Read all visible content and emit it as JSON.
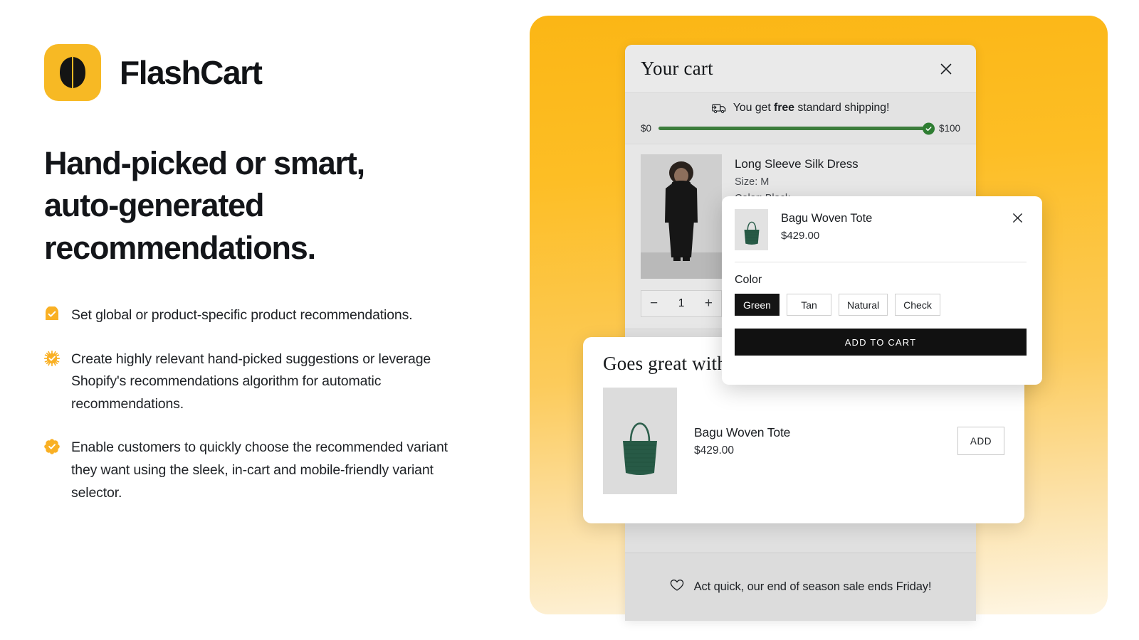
{
  "brand": {
    "name": "FlashCart",
    "logo_color": "#F7B924",
    "logo_icon": "two-leaf-mark-icon"
  },
  "headline": "Hand-picked or smart, auto-generated recommendations.",
  "bullets": [
    {
      "icon": "check-shield-icon",
      "text": "Set global or product-specific product recommendations."
    },
    {
      "icon": "check-burst-icon",
      "text": "Create highly relevant hand-picked suggestions or leverage Shopify's recommendations algorithm for automatic recommendations."
    },
    {
      "icon": "check-flower-icon",
      "text": "Enable customers to quickly choose the recommended variant they want using the sleek, in-cart and mobile-friendly variant selector."
    }
  ],
  "cart": {
    "title": "Your cart",
    "close_icon": "close-icon",
    "shipping": {
      "icon": "delivery-truck-icon",
      "message_pre": "You get ",
      "message_bold": "free",
      "message_post": " standard shipping!",
      "min_label": "$0",
      "max_label": "$100",
      "progress_percent": 100,
      "bar_color": "#3c7d3c",
      "check_icon": "check-circle-icon"
    },
    "item": {
      "title": "Long Sleeve Silk Dress",
      "size": "Size: M",
      "color": "Color: Black",
      "quantity": "1",
      "decrease_label": "−",
      "increase_label": "+",
      "delete_icon": "trash-icon"
    },
    "footer": {
      "icon": "heart-icon",
      "text": "Act quick, our end of season sale ends Friday!"
    }
  },
  "recommendations": {
    "title": "Goes great with",
    "product": {
      "name": "Bagu Woven Tote",
      "price": "$429.00",
      "image": "green-woven-tote-icon",
      "add_label": "ADD"
    }
  },
  "variant_popup": {
    "close_icon": "close-icon",
    "product": {
      "name": "Bagu Woven Tote",
      "price": "$429.00",
      "image": "green-woven-tote-icon"
    },
    "option_label": "Color",
    "options": [
      {
        "label": "Green",
        "selected": true
      },
      {
        "label": "Tan",
        "selected": false
      },
      {
        "label": "Natural",
        "selected": false
      },
      {
        "label": "Check",
        "selected": false
      }
    ],
    "add_to_cart_label": "ADD TO CART"
  }
}
